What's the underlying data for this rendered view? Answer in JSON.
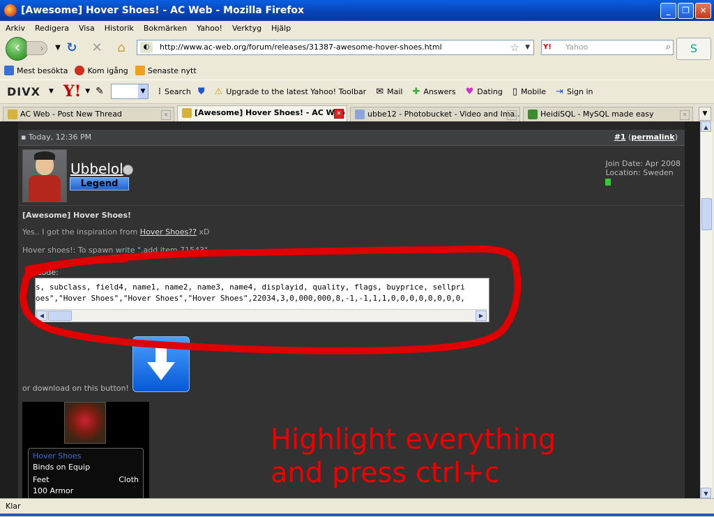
{
  "window": {
    "title": "[Awesome] Hover Shoes! - AC Web - Mozilla Firefox",
    "buttons": [
      "_",
      "❐",
      "✕"
    ]
  },
  "menu": [
    "Arkiv",
    "Redigera",
    "Visa",
    "Historik",
    "Bokmärken",
    "Yahoo!",
    "Verktyg",
    "Hjälp"
  ],
  "nav": {
    "url": "http://www.ac-web.org/forum/releases/31387-awesome-hover-shoes.html",
    "search_engine": "Y!",
    "search_placeholder": "Yahoo"
  },
  "bookmarks": [
    {
      "label": "Mest besökta",
      "color": "#3a6fd8"
    },
    {
      "label": "Kom igång",
      "color": "#c8321e"
    },
    {
      "label": "Senaste nytt",
      "color": "#f0a020"
    }
  ],
  "toolbar2": {
    "divx": "DIVX",
    "yahoo": "Y!",
    "search": "Search",
    "upgrade": "Upgrade to the latest Yahoo! Toolbar",
    "mail": "Mail",
    "answers": "Answers",
    "dating": "Dating",
    "mobile": "Mobile",
    "signin": "Sign in"
  },
  "tabs": [
    {
      "label": "AC Web - Post New Thread",
      "active": false
    },
    {
      "label": "[Awesome] Hover Shoes! - AC Web",
      "active": true
    },
    {
      "label": "ubbe12 - Photobucket - Video and Ima...",
      "active": false
    },
    {
      "label": "HeidiSQL - MySQL made easy",
      "active": false
    }
  ],
  "post": {
    "date": "Today, 12:36 PM",
    "number": "#1",
    "permalink": "permalink",
    "username": "Ubbelol",
    "rank": "Legend",
    "join_date": "Join Date: Apr 2008",
    "location": "Location: Sweden",
    "title": "[Awesome] Hover Shoes!",
    "inspiration_prefix": "Yes.. I got the inspiration from",
    "inspiration_link": "Hover Shoes??",
    "inspiration_suffix": "xD",
    "hover_line": "Hover shoes!: To spawn write \".add item 71543\"",
    "code_label": "Code:",
    "code_line1": "s, subclass, field4, name1, name2, name3, name4, displayid, quality, flags, buyprice, sellpri",
    "code_line2": "oes\",\"Hover Shoes\",\"Hover Shoes\",\"Hover Shoes\",22034,3,0,000,000,8,-1,-1,1,1,0,0,0,0,0,0,0,0,",
    "download_text": "or download on this button!"
  },
  "item": {
    "name": "Hover Shoes",
    "bind": "Binds on Equip",
    "slot": "Feet",
    "type": "Cloth",
    "armor": "100 Armor"
  },
  "annotation": {
    "line1": "Highlight everything",
    "line2": "and press ctrl+c"
  },
  "status": "Klar",
  "colors": {
    "annotation": "#e00000",
    "titlebar": "#0a5fe0",
    "forum_bg": "#323232"
  }
}
